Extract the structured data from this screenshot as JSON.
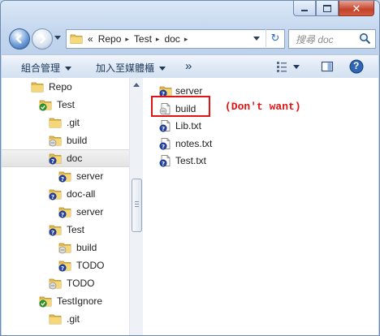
{
  "window": {
    "caption_buttons": {
      "minimize": "minimize",
      "maximize": "maximize",
      "close": "✕"
    }
  },
  "nav": {
    "back_icon": "back-arrow-icon",
    "forward_icon": "forward-arrow-icon",
    "breadcrumb": {
      "overflow": "«",
      "items": [
        "Repo",
        "Test",
        "doc"
      ],
      "separator": "▸"
    },
    "refresh_glyph": "↻",
    "search_placeholder": "搜尋 doc"
  },
  "toolbar": {
    "organize": "組合管理",
    "add_to_library": "加入至媒體櫃",
    "more": "»",
    "view_icon": "view-options-icon",
    "preview_icon": "preview-pane-icon",
    "help_glyph": "?"
  },
  "tree": [
    {
      "label": "Repo",
      "indent": 0,
      "icon": "folder"
    },
    {
      "label": "Test",
      "indent": 1,
      "icon": "svn-normal"
    },
    {
      "label": ".git",
      "indent": 2,
      "icon": "folder"
    },
    {
      "label": "build",
      "indent": 2,
      "icon": "svn-ignored"
    },
    {
      "label": "doc",
      "indent": 2,
      "icon": "svn-unversioned",
      "selected": true
    },
    {
      "label": "server",
      "indent": 3,
      "icon": "svn-unversioned"
    },
    {
      "label": "doc-all",
      "indent": 2,
      "icon": "svn-unversioned"
    },
    {
      "label": "server",
      "indent": 3,
      "icon": "svn-unversioned"
    },
    {
      "label": "Test",
      "indent": 2,
      "icon": "svn-unversioned"
    },
    {
      "label": "build",
      "indent": 3,
      "icon": "svn-ignored"
    },
    {
      "label": "TODO",
      "indent": 3,
      "icon": "svn-unversioned"
    },
    {
      "label": "TODO",
      "indent": 2,
      "icon": "svn-ignored"
    },
    {
      "label": "TestIgnore",
      "indent": 1,
      "icon": "svn-normal"
    },
    {
      "label": ".git",
      "indent": 2,
      "icon": "folder"
    }
  ],
  "files": [
    {
      "label": "server",
      "icon": "svn-unversioned"
    },
    {
      "label": "build",
      "icon": "svn-ignored-doc"
    },
    {
      "label": "Lib.txt",
      "icon": "svn-unversioned-doc"
    },
    {
      "label": "notes.txt",
      "icon": "svn-unversioned-doc"
    },
    {
      "label": "Test.txt",
      "icon": "svn-unversioned-doc"
    }
  ],
  "annotation": {
    "text": "(Don't want)",
    "color": "#e01414"
  },
  "colors": {
    "accent": "#2d6fb8",
    "highlight": "#e01414",
    "unversioned": "#2443a8",
    "normal": "#2c9b2c"
  }
}
